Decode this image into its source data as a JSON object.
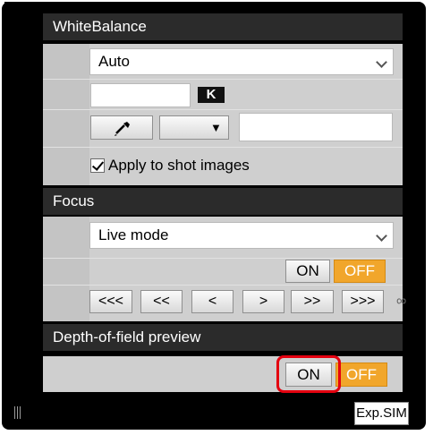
{
  "white_balance": {
    "title": "WhiteBalance",
    "mode_value": "Auto",
    "k_unit": "K",
    "color_temp_value": "",
    "preset_value": "",
    "apply_label": "Apply to shot images",
    "apply_checked": true,
    "eyedropper_icon": "eyedropper-icon",
    "dropdown_arrow": "▼"
  },
  "focus": {
    "title": "Focus",
    "mode_value": "Live mode",
    "on_label": "ON",
    "off_label": "OFF",
    "nav": [
      "<<<",
      "<<",
      "<",
      ">",
      ">>",
      ">>>"
    ],
    "infinity": "∞"
  },
  "dof": {
    "title": "Depth-of-field preview",
    "on_label": "ON",
    "off_label": "OFF"
  },
  "exp_sim": "Exp.SIM",
  "colors": {
    "header_bg": "#2b2b2b",
    "panel_bg": "#cfcfcf",
    "off_orange": "#f1a62b",
    "highlight_red": "#e4000f"
  }
}
